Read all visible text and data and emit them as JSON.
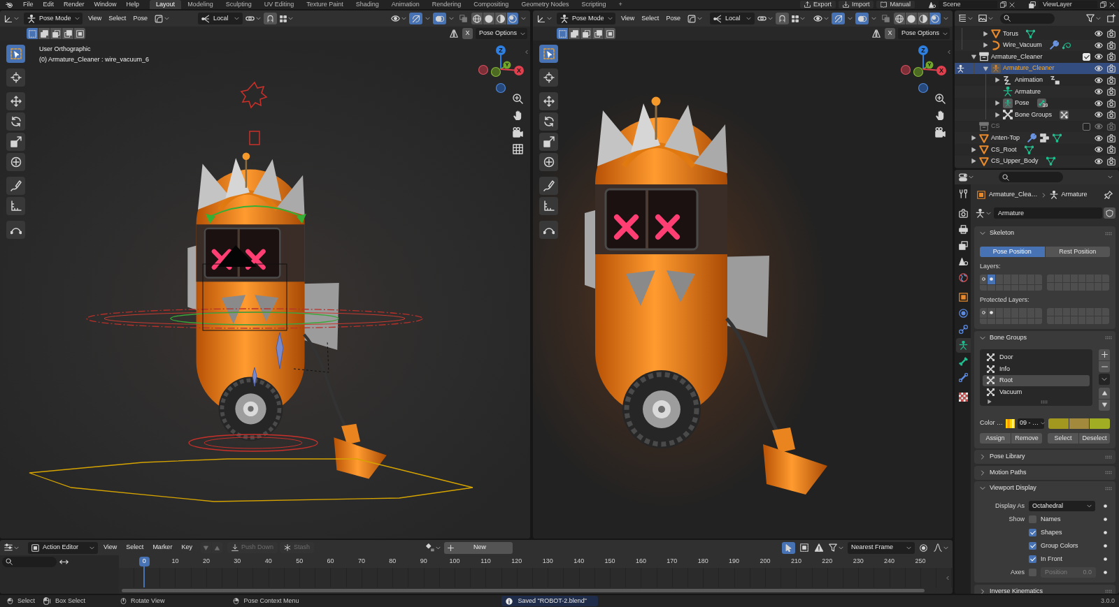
{
  "top_bar": {
    "menus": [
      "File",
      "Edit",
      "Render",
      "Window",
      "Help"
    ],
    "workspaces": [
      {
        "label": "Layout",
        "selected": true
      },
      {
        "label": "Modeling",
        "selected": false
      },
      {
        "label": "Sculpting",
        "selected": false
      },
      {
        "label": "UV Editing",
        "selected": false
      },
      {
        "label": "Texture Paint",
        "selected": false
      },
      {
        "label": "Shading",
        "selected": false
      },
      {
        "label": "Animation",
        "selected": false
      },
      {
        "label": "Rendering",
        "selected": false
      },
      {
        "label": "Compositing",
        "selected": false
      },
      {
        "label": "Geometry Nodes",
        "selected": false
      },
      {
        "label": "Scripting",
        "selected": false
      }
    ],
    "add_workspace": "+",
    "actions": [
      {
        "kind": "export",
        "label": "Export"
      },
      {
        "kind": "import",
        "label": "Import"
      },
      {
        "kind": "manual",
        "label": "Manual"
      }
    ],
    "scene": "Scene",
    "view_layer": "ViewLayer"
  },
  "viewports": [
    {
      "mode": "Pose Mode",
      "menus": [
        "View",
        "Select",
        "Pose"
      ],
      "orientation": "Local",
      "snap_on": false,
      "gizmos_on": true,
      "overlays_on": true,
      "xray_on": false,
      "shading": [
        {
          "kind": "wireframe",
          "selected": false
        },
        {
          "kind": "solid",
          "selected": false
        },
        {
          "kind": "material",
          "selected": false
        },
        {
          "kind": "rendered",
          "selected": true
        }
      ],
      "select_modes": [
        {
          "kind": "set",
          "selected": true
        },
        {
          "kind": "extend",
          "selected": false
        },
        {
          "kind": "subtract",
          "selected": false
        },
        {
          "kind": "invert",
          "selected": false
        },
        {
          "kind": "intersect",
          "selected": false
        }
      ],
      "mirror_x": {
        "label": "X",
        "on": false
      },
      "pose_options": "Pose Options",
      "view_name": "User Orthographic",
      "view_object": "(0) Armature_Cleaner : wire_vacuum_6",
      "axes": [
        "Z",
        "Y",
        "X"
      ],
      "tools": [
        {
          "kind": "select_box",
          "selected": true
        },
        {
          "kind": "cursor",
          "selected": false
        },
        {
          "kind": "move",
          "selected": false
        },
        {
          "kind": "rotate",
          "selected": false
        },
        {
          "kind": "scale",
          "selected": false
        },
        {
          "kind": "transform",
          "selected": false
        },
        {
          "kind": "annotate",
          "selected": false
        },
        {
          "kind": "measure",
          "selected": false
        },
        {
          "kind": "bend",
          "selected": false
        }
      ],
      "nav": [
        {
          "kind": "zoom"
        },
        {
          "kind": "pan"
        },
        {
          "kind": "camera"
        },
        {
          "kind": "grid"
        }
      ],
      "rig_overlay": true
    },
    {
      "mode": "Pose Mode",
      "menus": [
        "View",
        "Select",
        "Pose"
      ],
      "orientation": "Local",
      "snap_on": false,
      "gizmos_on": true,
      "overlays_on": true,
      "xray_on": false,
      "shading": [
        {
          "kind": "wireframe",
          "selected": false
        },
        {
          "kind": "solid",
          "selected": false
        },
        {
          "kind": "material",
          "selected": false
        },
        {
          "kind": "rendered",
          "selected": true
        }
      ],
      "select_modes": [
        {
          "kind": "set",
          "selected": true
        },
        {
          "kind": "extend",
          "selected": false
        },
        {
          "kind": "subtract",
          "selected": false
        },
        {
          "kind": "invert",
          "selected": false
        },
        {
          "kind": "intersect",
          "selected": false
        }
      ],
      "mirror_x": {
        "label": "X",
        "on": false
      },
      "pose_options": "Pose Options",
      "axes": [
        "Z",
        "Y",
        "X"
      ],
      "tools": [
        {
          "kind": "select_box",
          "selected": true
        },
        {
          "kind": "cursor",
          "selected": false
        },
        {
          "kind": "move",
          "selected": false
        },
        {
          "kind": "rotate",
          "selected": false
        },
        {
          "kind": "scale",
          "selected": false
        },
        {
          "kind": "transform",
          "selected": false
        },
        {
          "kind": "annotate",
          "selected": false
        },
        {
          "kind": "measure",
          "selected": false
        },
        {
          "kind": "bend",
          "selected": false
        }
      ],
      "nav": [
        {
          "kind": "zoom"
        },
        {
          "kind": "pan"
        },
        {
          "kind": "camera"
        }
      ],
      "rig_overlay": false
    }
  ],
  "outliner": {
    "continued": [
      {
        "label": "Torus",
        "kind": "mesh",
        "expanded": false,
        "selected": false,
        "extras": [
          {
            "kind": "mesh_data"
          }
        ]
      },
      {
        "label": "Wire_Vacuum",
        "kind": "curve",
        "expanded": false,
        "selected": false,
        "extras": [
          {
            "kind": "modifier"
          },
          {
            "kind": "curve_data"
          }
        ]
      }
    ],
    "items": [
      {
        "label": "Armature_Cleaner",
        "kind": "collection",
        "expanded": true,
        "checked": true,
        "selected": false,
        "children": [
          {
            "label": "Armature_Cleaner",
            "kind": "armature",
            "expanded": true,
            "selected": true,
            "pose_mode": true,
            "children": [
              {
                "label": "Animation",
                "kind": "animation",
                "expanded": false,
                "selected": false,
                "extras": [
                  {
                    "kind": "action"
                  }
                ]
              },
              {
                "label": "Armature",
                "kind": "armature_data",
                "selected": false
              },
              {
                "label": "Pose",
                "kind": "pose",
                "expanded": false,
                "selected": false,
                "extras": [
                  {
                    "kind": "bones",
                    "count": "39"
                  }
                ]
              },
              {
                "label": "Bone Groups",
                "kind": "bone_groups",
                "expanded": false,
                "selected": false,
                "extras": [
                  {
                    "kind": "bone_groups",
                    "count": "4"
                  }
                ]
              }
            ]
          }
        ]
      },
      {
        "label": "CS",
        "kind": "collection",
        "checked": false,
        "selected": false
      },
      {
        "label": "Anten-Top",
        "kind": "mesh",
        "expanded": false,
        "selected": false,
        "extras": [
          {
            "kind": "modifier"
          },
          {
            "kind": "vertex_groups"
          },
          {
            "kind": "mesh_data"
          }
        ]
      },
      {
        "label": "CS_Root",
        "kind": "mesh",
        "expanded": false,
        "selected": false,
        "extras": [
          {
            "kind": "mesh_data"
          }
        ]
      },
      {
        "label": "CS_Upper_Body",
        "kind": "mesh",
        "expanded": false,
        "selected": false,
        "extras": [
          {
            "kind": "mesh_data"
          }
        ]
      }
    ]
  },
  "properties": {
    "tabs": [
      {
        "kind": "tool",
        "selected": false
      },
      {
        "kind": "render",
        "selected": false
      },
      {
        "kind": "output",
        "selected": false
      },
      {
        "kind": "view_layer",
        "selected": false
      },
      {
        "kind": "scene",
        "selected": false
      },
      {
        "kind": "world",
        "selected": false
      },
      {
        "kind": "object",
        "selected": false
      },
      {
        "kind": "physics",
        "selected": false
      },
      {
        "kind": "constraints",
        "selected": false
      },
      {
        "kind": "armature",
        "selected": true
      },
      {
        "kind": "bone",
        "selected": false
      },
      {
        "kind": "bone_constraints",
        "selected": false
      },
      {
        "kind": "texture",
        "selected": false
      }
    ],
    "breadcrumb": [
      {
        "kind": "object",
        "label": "Armature_Clea…"
      },
      {
        "kind": "armature",
        "label": "Armature"
      }
    ],
    "datablock": "Armature",
    "panels": [
      {
        "kind": "skeleton",
        "title": "Skeleton",
        "expanded": true,
        "positions": [
          {
            "label": "Pose Position",
            "selected": true
          },
          {
            "label": "Rest Position",
            "selected": false
          }
        ],
        "layers_label": "Layers:",
        "layers": [
          {
            "kind": "ring",
            "on": false
          },
          {
            "kind": "dot",
            "on": true
          },
          {
            "kind": "empty",
            "on": false
          },
          {
            "kind": "empty",
            "on": false
          },
          {
            "kind": "empty",
            "on": false
          },
          {
            "kind": "empty",
            "on": false
          },
          {
            "kind": "empty",
            "on": false
          },
          {
            "kind": "empty",
            "on": false
          },
          {
            "kind": "empty",
            "on": false
          },
          {
            "kind": "empty",
            "on": false
          },
          {
            "kind": "empty",
            "on": false
          },
          {
            "kind": "empty",
            "on": false
          },
          {
            "kind": "empty",
            "on": false
          },
          {
            "kind": "empty",
            "on": false
          },
          {
            "kind": "empty",
            "on": false
          },
          {
            "kind": "empty",
            "on": false
          },
          {
            "kind": "empty",
            "on": false
          },
          {
            "kind": "empty",
            "on": false
          },
          {
            "kind": "empty",
            "on": false
          },
          {
            "kind": "empty",
            "on": false
          },
          {
            "kind": "empty",
            "on": false
          },
          {
            "kind": "empty",
            "on": false
          },
          {
            "kind": "empty",
            "on": false
          },
          {
            "kind": "empty",
            "on": false
          },
          {
            "kind": "empty",
            "on": false
          },
          {
            "kind": "empty",
            "on": false
          },
          {
            "kind": "empty",
            "on": false
          },
          {
            "kind": "empty",
            "on": false
          },
          {
            "kind": "empty",
            "on": false
          },
          {
            "kind": "empty",
            "on": false
          },
          {
            "kind": "empty",
            "on": false
          },
          {
            "kind": "empty",
            "on": false
          }
        ],
        "protected_label": "Protected Layers:",
        "protected_layers": [
          {
            "kind": "ring",
            "on": false
          },
          {
            "kind": "dot",
            "on": false
          },
          {
            "kind": "empty",
            "on": false
          },
          {
            "kind": "empty",
            "on": false
          },
          {
            "kind": "empty",
            "on": false
          },
          {
            "kind": "empty",
            "on": false
          },
          {
            "kind": "empty",
            "on": false
          },
          {
            "kind": "empty",
            "on": false
          },
          {
            "kind": "empty",
            "on": false
          },
          {
            "kind": "empty",
            "on": false
          },
          {
            "kind": "empty",
            "on": false
          },
          {
            "kind": "empty",
            "on": false
          },
          {
            "kind": "empty",
            "on": false
          },
          {
            "kind": "empty",
            "on": false
          },
          {
            "kind": "empty",
            "on": false
          },
          {
            "kind": "empty",
            "on": false
          },
          {
            "kind": "empty",
            "on": false
          },
          {
            "kind": "empty",
            "on": false
          },
          {
            "kind": "empty",
            "on": false
          },
          {
            "kind": "empty",
            "on": false
          },
          {
            "kind": "empty",
            "on": false
          },
          {
            "kind": "empty",
            "on": false
          },
          {
            "kind": "empty",
            "on": false
          },
          {
            "kind": "empty",
            "on": false
          },
          {
            "kind": "empty",
            "on": false
          },
          {
            "kind": "empty",
            "on": false
          },
          {
            "kind": "empty",
            "on": false
          },
          {
            "kind": "empty",
            "on": false
          },
          {
            "kind": "empty",
            "on": false
          },
          {
            "kind": "empty",
            "on": false
          },
          {
            "kind": "empty",
            "on": false
          },
          {
            "kind": "empty",
            "on": false
          }
        ]
      },
      {
        "kind": "bone_groups",
        "title": "Bone Groups",
        "expanded": true,
        "groups": [
          {
            "label": "Door",
            "selected": false
          },
          {
            "label": "Info",
            "selected": false
          },
          {
            "label": "Root",
            "selected": true
          },
          {
            "label": "Vacuum",
            "selected": false
          }
        ],
        "color_label": "Color …",
        "color_set": "09 - …",
        "swatches": [
          {
            "color": "#a2981f"
          },
          {
            "color": "#a3893c"
          },
          {
            "color": "#a1ad22"
          }
        ],
        "buttons": [
          "Assign",
          "Remove",
          "Select",
          "Deselect"
        ]
      },
      {
        "title": "Pose Library",
        "expanded": false
      },
      {
        "title": "Motion Paths",
        "expanded": false
      },
      {
        "kind": "viewport_display",
        "title": "Viewport Display",
        "expanded": true,
        "display_as_label": "Display As",
        "display_as": "Octahedral",
        "show_label": "Show",
        "options": [
          {
            "label": "Names",
            "checked": false
          },
          {
            "label": "Shapes",
            "checked": true
          },
          {
            "label": "Group Colors",
            "checked": true
          },
          {
            "label": "In Front",
            "checked": true
          }
        ],
        "axes_label": "Axes",
        "axes_checked": false,
        "axes_position": {
          "label": "Position",
          "value": "0.0",
          "disabled": true
        }
      },
      {
        "title": "Inverse Kinematics",
        "expanded": false
      }
    ]
  },
  "action_editor": {
    "editor": "Action Editor",
    "menus": [
      "View",
      "Select",
      "Marker",
      "Key"
    ],
    "actions": [
      {
        "kind": "push_down",
        "label": "Push Down",
        "disabled": true
      },
      {
        "kind": "stash",
        "label": "Stash",
        "disabled": true
      }
    ],
    "new_label": "New",
    "only_selected": true,
    "snap": "Nearest Frame",
    "frames": [
      {
        "label": "0",
        "selected": true
      },
      {
        "label": "10",
        "selected": false
      },
      {
        "label": "20",
        "selected": false
      },
      {
        "label": "30",
        "selected": false
      },
      {
        "label": "40",
        "selected": false
      },
      {
        "label": "50",
        "selected": false
      },
      {
        "label": "60",
        "selected": false
      },
      {
        "label": "70",
        "selected": false
      },
      {
        "label": "80",
        "selected": false
      },
      {
        "label": "90",
        "selected": false
      },
      {
        "label": "100",
        "selected": false
      },
      {
        "label": "110",
        "selected": false
      },
      {
        "label": "120",
        "selected": false
      },
      {
        "label": "130",
        "selected": false
      },
      {
        "label": "140",
        "selected": false
      },
      {
        "label": "150",
        "selected": false
      },
      {
        "label": "160",
        "selected": false
      },
      {
        "label": "170",
        "selected": false
      },
      {
        "label": "180",
        "selected": false
      },
      {
        "label": "190",
        "selected": false
      },
      {
        "label": "200",
        "selected": false
      },
      {
        "label": "210",
        "selected": false
      },
      {
        "label": "220",
        "selected": false
      },
      {
        "label": "230",
        "selected": false
      },
      {
        "label": "240",
        "selected": false
      },
      {
        "label": "250",
        "selected": false
      }
    ]
  },
  "status_bar": {
    "hints": [
      {
        "kind": "left_click",
        "label": "Select"
      },
      {
        "kind": "left_drag",
        "label": "Box Select"
      },
      {
        "kind": "middle_click",
        "label": "Rotate View"
      },
      {
        "kind": "right_click",
        "label": "Pose Context Menu"
      }
    ],
    "report": "Saved \"ROBOT-2.blend\"",
    "version": "3.0.0"
  }
}
